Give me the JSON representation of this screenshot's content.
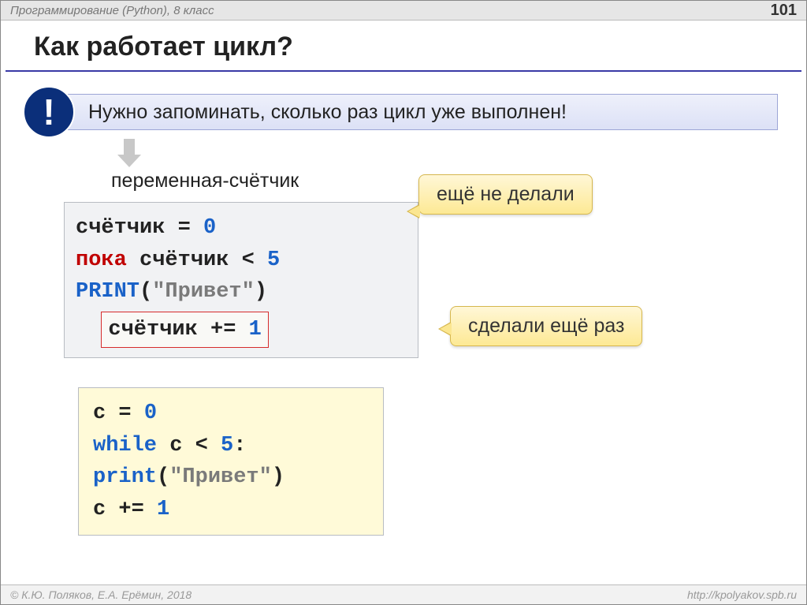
{
  "header": {
    "subject": "Программирование (Python), 8 класс",
    "page_number": "101"
  },
  "title": "Как работает цикл?",
  "important": {
    "bang": "!",
    "text": "Нужно запоминать, сколько раз цикл уже выполнен!"
  },
  "counter_label": "переменная-счётчик",
  "pseudocode": {
    "line1_a": "счётчик = ",
    "line1_b": "0",
    "line2_a": "пока",
    "line2_b": " счётчик < ",
    "line2_c": "5",
    "line3_a": "  ",
    "line3_fn": "PRINT",
    "line3_paren1": "(",
    "line3_str": "\"Привет\"",
    "line3_paren2": ")",
    "line4_a": "счётчик += ",
    "line4_b": "1"
  },
  "callouts": {
    "not_done": "ещё не делали",
    "done_again": "сделали ещё раз"
  },
  "pycode": {
    "line1_a": "c = ",
    "line1_b": "0",
    "line2_a": "while",
    "line2_b": " c < ",
    "line2_c": "5",
    "line2_d": ":",
    "line3_ind": " ",
    "line3_fn": "print",
    "line3_paren1": "(",
    "line3_str": "\"Привет\"",
    "line3_paren2": ")",
    "line4_ind": " ",
    "line4_a": "c += ",
    "line4_b": "1"
  },
  "footer": {
    "authors": "© К.Ю. Поляков, Е.А. Ерёмин, 2018",
    "url": "http://kpolyakov.spb.ru"
  }
}
